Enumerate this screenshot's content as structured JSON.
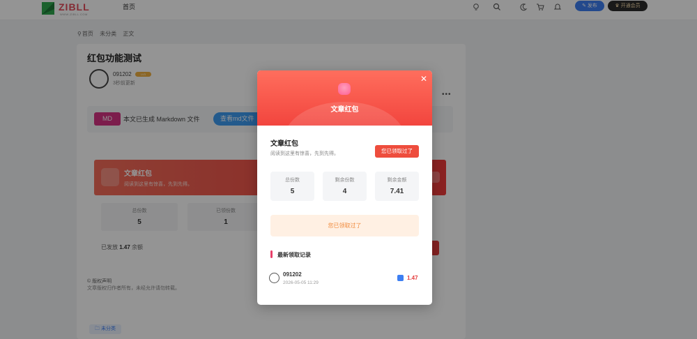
{
  "header": {
    "logo_text": "ZIBLL",
    "logo_sub": "WWW.ZIBLL.COM",
    "nav_home": "首页",
    "publish_label": "发布",
    "vip_label": "开通会员"
  },
  "breadcrumb": [
    "首页",
    "未分类",
    "正文"
  ],
  "article": {
    "title": "红包功能测试",
    "author": "091202",
    "level": "LV3",
    "updated": "3秒前更新",
    "md_badge": "MD",
    "md_text": "本文已生成 Markdown 文件",
    "md_button": "查看md文件",
    "rp_title": "文章红包",
    "rp_sub": "阅读到这里有惊喜，先到先得。",
    "stats": [
      {
        "label": "总份数",
        "value": "5"
      },
      {
        "label": "已领份数",
        "value": "1"
      }
    ],
    "issued_prefix": "已发放",
    "issued_amount": "1.47",
    "issued_suffix": "余额",
    "copyright_title": "© 版权声明",
    "copyright_text": "文章版权归作者所有，未经允许请勿转载。",
    "tag": "未分类"
  },
  "modal": {
    "header_title": "文章红包",
    "title": "文章红包",
    "desc": "阅读到这里有惊喜，先到先得。",
    "claimed_tag": "您已领取过了",
    "stats": [
      {
        "label": "总份数",
        "value": "5"
      },
      {
        "label": "剩余份数",
        "value": "4"
      },
      {
        "label": "剩余金额",
        "value": "7.41"
      }
    ],
    "claimed_button": "您已领取过了",
    "section_title": "最新领取记录",
    "records": [
      {
        "name": "091202",
        "time": "2026-05-05 11:29",
        "amount": "1.47"
      }
    ]
  },
  "colors": {
    "accent_red": "#ee4d3d",
    "primary_blue": "#3d7ff2",
    "pink": "#e8406a"
  }
}
